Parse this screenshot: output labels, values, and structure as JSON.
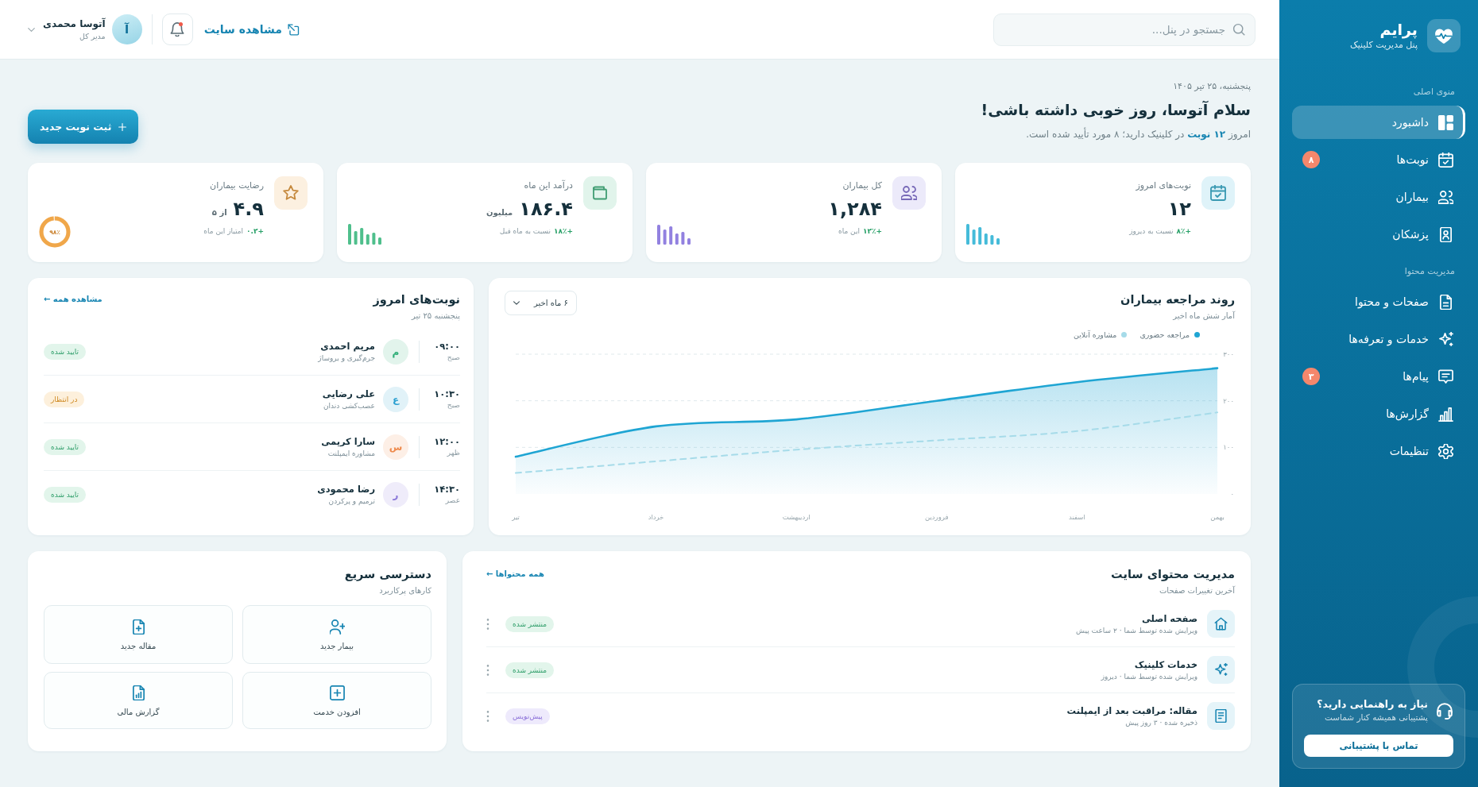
{
  "sidebar": {
    "brand": {
      "name": "پرایم",
      "tagline": "پنل مدیریت کلینیک"
    },
    "sections": [
      {
        "title": "منوی اصلی",
        "items": [
          {
            "label": "داشبورد",
            "selected": true
          },
          {
            "label": "نوبت‌ها",
            "selected": false,
            "badge": "۸"
          },
          {
            "label": "بیماران",
            "selected": false
          },
          {
            "label": "پزشکان",
            "selected": false
          }
        ]
      },
      {
        "title": "مدیریت محتوا",
        "items": [
          {
            "label": "صفحات و محتوا",
            "selected": false
          },
          {
            "label": "خدمات و تعرفه‌ها",
            "selected": false
          },
          {
            "label": "پیام‌ها",
            "selected": false,
            "badge": "۳"
          },
          {
            "label": "گزارش‌ها",
            "selected": false
          },
          {
            "label": "تنظیمات",
            "selected": false
          }
        ]
      }
    ],
    "help": {
      "title": "نیاز به راهنمایی دارید؟",
      "text": "پشتیبانی همیشه کنار شماست",
      "button": "تماس با پشتیبانی"
    }
  },
  "header": {
    "search": {
      "placeholder": "جستجو در پنل..."
    },
    "view_site": "مشاهده سایت",
    "notifications": {
      "unread": true
    },
    "user": {
      "initial": "آ",
      "name": "آتوسا محمدی",
      "role": "مدیر کل"
    }
  },
  "greeting": {
    "date": "پنجشنبه، ۲۵ تیر ۱۴۰۵",
    "title": "سلام آتوسا، روز خوبی داشته باشی!",
    "subtitle": "امروز **۱۲ نوبت** در کلینیک دارید؛ ۸ مورد تأیید شده است.",
    "button": "ثبت نوبت جدید"
  },
  "stats": [
    {
      "kind": "bars",
      "label": "نوبت‌های امروز",
      "value": "۱۲",
      "change": "+۸٪",
      "note": "نسبت به دیروز",
      "color": "#45bbd9"
    },
    {
      "kind": "bars",
      "label": "کل بیماران",
      "value": "۱,۲۸۴",
      "change": "+۱۲٪",
      "note": "این ماه",
      "color": "#9281e0"
    },
    {
      "kind": "bars",
      "label": "درآمد این ماه",
      "value": "۱۸۶.۴",
      "unit": "میلیون",
      "change": "+۱۸٪",
      "note": "نسبت به ماه قبل",
      "color": "#4fbf8c"
    },
    {
      "kind": "ring",
      "label": "رضایت بیماران",
      "value": "۴.۹",
      "unit": "از ۵",
      "change": "+۰.۲",
      "note": "امتیاز این ماه",
      "color": "#f0a74a",
      "level": 0.98,
      "ring_label": "۹۸٪"
    }
  ],
  "trend": {
    "subtitle": "آمار شش ماه اخیر",
    "range": "۶ ماه اخیر",
    "chart_data": {
      "type": "area",
      "title": "روند مراجعه بیماران",
      "categories": [
        "تیر",
        "خرداد",
        "اردیبهشت",
        "فروردین",
        "اسفند",
        "بهمن"
      ],
      "series": [
        {
          "name": "مراجعه حضوری",
          "type": "area",
          "color": "#1fa5d3",
          "values": [
            80,
            145,
            160,
            200,
            240,
            270
          ]
        },
        {
          "name": "مشاوره آنلاین",
          "type": "line",
          "line_style": "dashed",
          "color": "#a6dbe9",
          "values": [
            45,
            70,
            95,
            115,
            135,
            175
          ]
        }
      ],
      "ylim": [
        0,
        300
      ],
      "yticks": [
        {
          "value": 0,
          "label": "۰"
        },
        {
          "value": 100,
          "label": "۱۰۰"
        },
        {
          "value": 200,
          "label": "۲۰۰"
        },
        {
          "value": 300,
          "label": "۳۰۰"
        }
      ]
    }
  },
  "appointments": {
    "title": "نوبت‌های امروز",
    "subtitle": "پنجشنبه ۲۵ تیر",
    "link": "مشاهده همه ←",
    "rows": [
      {
        "time": "۰۹:۰۰",
        "period": "صبح",
        "initial": "م",
        "color": "#2fae78",
        "name": "مریم احمدی",
        "service": "جرم‌گیری و بروساژ",
        "status": "تایید شده",
        "kind": "confirmed"
      },
      {
        "time": "۱۰:۳۰",
        "period": "صبح",
        "initial": "ع",
        "color": "#2a9fd0",
        "name": "علی رضایی",
        "service": "عصب‌کشی دندان",
        "status": "در انتظار",
        "kind": "pending"
      },
      {
        "time": "۱۲:۰۰",
        "period": "ظهر",
        "initial": "س",
        "color": "#ee8a4c",
        "name": "سارا کریمی",
        "service": "مشاوره ایمپلنت",
        "status": "تایید شده",
        "kind": "confirmed"
      },
      {
        "time": "۱۴:۳۰",
        "period": "عصر",
        "initial": "ر",
        "color": "#8b79d9",
        "name": "رضا محمودی",
        "service": "ترمیم و پرکردن",
        "status": "تایید شده",
        "kind": "confirmed"
      }
    ]
  },
  "content": {
    "title": "مدیریت محتوای سایت",
    "subtitle": "آخرین تغییرات صفحات",
    "link": "همه محتواها ←",
    "rows": [
      {
        "title": "صفحه اصلی",
        "meta": "ویرایش شده توسط شما · ۲ ساعت پیش",
        "status": "منتشر شده",
        "kind": "published"
      },
      {
        "title": "خدمات کلینیک",
        "meta": "ویرایش شده توسط شما · دیروز",
        "status": "منتشر شده",
        "kind": "published"
      },
      {
        "title": "مقاله: مراقبت بعد از ایمپلنت",
        "meta": "ذخیره شده · ۳ روز پیش",
        "status": "پیش‌نویس",
        "kind": "draft"
      }
    ]
  },
  "quick_access": {
    "title": "دسترسی سریع",
    "subtitle": "کارهای پرکاربرد",
    "actions": [
      "بیمار جدید",
      "مقاله جدید",
      "افزودن خدمت",
      "گزارش مالی"
    ]
  }
}
